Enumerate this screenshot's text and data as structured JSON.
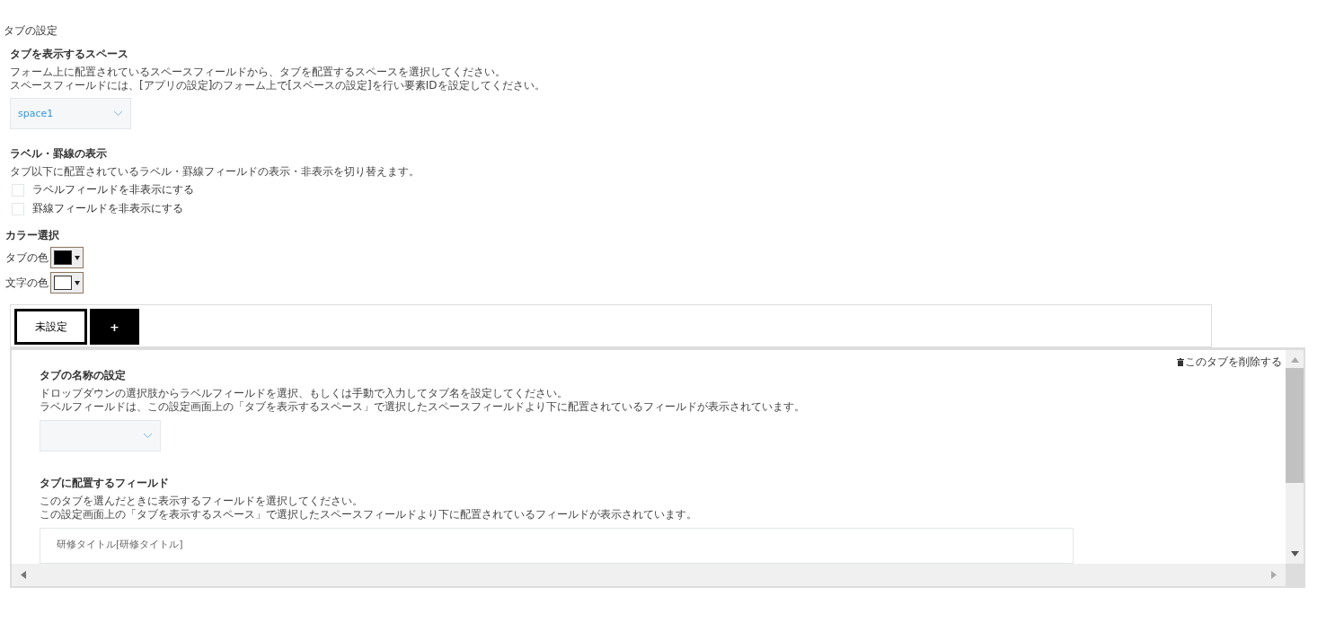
{
  "title": "タブの設定",
  "space_section": {
    "heading": "タブを表示するスペース",
    "description": [
      "フォーム上に配置されているスペースフィールドから、タブを配置するスペースを選択してください。",
      "スペースフィールドには、[アプリの設定]のフォーム上で[スペースの設定]を行い要素IDを設定してください。"
    ],
    "select_value": "space1"
  },
  "label_section": {
    "heading": "ラベル・罫線の表示",
    "description": "タブ以下に配置されているラベル・罫線フィールドの表示・非表示を切り替えます。",
    "options": [
      {
        "label": "ラベルフィールドを非表示にする",
        "checked": false
      },
      {
        "label": "罫線フィールドを非表示にする",
        "checked": false
      }
    ]
  },
  "color_section": {
    "heading": "カラー選択",
    "pickers": [
      {
        "label": "タブの色",
        "color": "#000000"
      },
      {
        "label": "文字の色",
        "color": "#ffffff"
      }
    ]
  },
  "tabs": [
    {
      "label": "未設定",
      "selected": true
    }
  ],
  "add_tab_button": "+",
  "panel": {
    "delete_link": "このタブを削除する",
    "name_section": {
      "heading": "タブの名称の設定",
      "description": [
        "ドロップダウンの選択肢からラベルフィールドを選択、もしくは手動で入力してタブ名を設定してください。",
        "ラベルフィールドは、この設定画面上の「タブを表示するスペース」で選択したスペースフィールドより下に配置されているフィールドが表示されています。"
      ]
    },
    "fields_section": {
      "heading": "タブに配置するフィールド",
      "description": [
        "このタブを選んだときに表示するフィールドを選択してください。",
        "この設定画面上の「タブを表示するスペース」で選択したスペースフィールドより下に配置されているフィールドが表示されています。"
      ],
      "fields": [
        "研修タイトル[研修タイトル]"
      ]
    }
  }
}
